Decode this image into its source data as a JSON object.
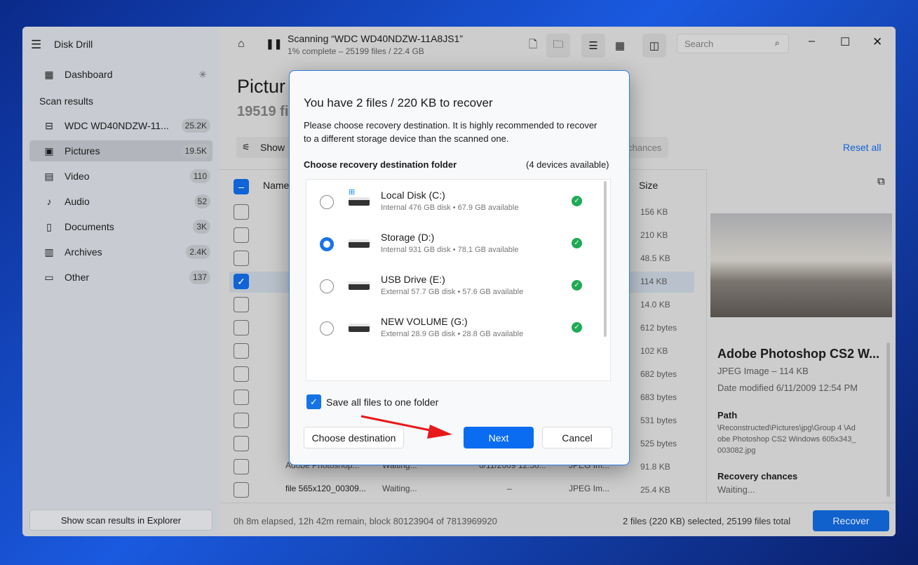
{
  "app": {
    "title": "Disk Drill"
  },
  "sidebar": {
    "dashboard": "Dashboard",
    "section": "Scan results",
    "items": [
      {
        "label": "WDC WD40NDZW-11...",
        "count": "25.2K",
        "icon": "hdd-icon"
      },
      {
        "label": "Pictures",
        "count": "19.5K",
        "icon": "picture-icon"
      },
      {
        "label": "Video",
        "count": "110",
        "icon": "film-icon"
      },
      {
        "label": "Audio",
        "count": "52",
        "icon": "music-icon"
      },
      {
        "label": "Documents",
        "count": "3K",
        "icon": "document-icon"
      },
      {
        "label": "Archives",
        "count": "2.4K",
        "icon": "archive-icon"
      },
      {
        "label": "Other",
        "count": "137",
        "icon": "other-icon"
      }
    ],
    "explorer_button": "Show scan results in Explorer"
  },
  "header": {
    "title": "Scanning “WDC WD40NDZW-11A8JS1”",
    "subtitle": "1% complete – 25199 files / 22.4 GB",
    "search_placeholder": "Search"
  },
  "page": {
    "title": "Pictur",
    "count": "19519 fil",
    "show_label": "Show",
    "chances_label": "chances",
    "reset_all": "Reset all"
  },
  "table": {
    "col_name": "Name",
    "col_size": "Size",
    "sizes": [
      "156 KB",
      "210 KB",
      "48.5 KB",
      "114 KB",
      "14.0 KB",
      "612 bytes",
      "102 KB",
      "682 bytes",
      "683 bytes",
      "531 bytes",
      "525 bytes",
      "91.8 KB",
      "25.4 KB"
    ],
    "checked_index": 3,
    "partial_rows": [
      {
        "name": "Adobe Photoshop...",
        "status": "Waiting...",
        "date": "6/11/2009 12:50...",
        "type": "JPEG Im..."
      },
      {
        "name": "file 565x120_00309...",
        "status": "Waiting...",
        "date": "–",
        "type": "JPEG Im..."
      }
    ]
  },
  "preview": {
    "title": "Adobe Photoshop CS2 W...",
    "type": "JPEG Image – 114 KB",
    "date": "Date modified 6/11/2009 12:54 PM",
    "path_label": "Path",
    "path": "\\Reconstructed\\Pictures\\jpg\\Group 4 \\Adobe Photoshop CS2 Windows 605x343_003082.jpg",
    "chances_label": "Recovery chances",
    "chances": "Waiting..."
  },
  "footer": {
    "elapsed": "0h 8m elapsed, 12h 42m remain, block 80123904 of 7813969920",
    "selection": "2 files (220 KB) selected, 25199 files total",
    "recover": "Recover"
  },
  "dialog": {
    "title": "You have 2 files / 220 KB to recover",
    "desc": "Please choose recovery destination. It is highly recommended to recover to a different storage device than the scanned one.",
    "folder_label": "Choose recovery destination folder",
    "devices_count": "(4 devices available)",
    "devices": [
      {
        "name": "Local Disk (C:)",
        "detail": "Internal 476 GB disk • 67.9 GB available",
        "selected": false
      },
      {
        "name": "Storage (D:)",
        "detail": "Internal 931 GB disk • 78.1 GB available",
        "selected": true
      },
      {
        "name": "USB Drive (E:)",
        "detail": "External 57.7 GB disk • 57.6 GB available",
        "selected": false
      },
      {
        "name": "NEW VOLUME (G:)",
        "detail": "External 28.9 GB disk • 28.8 GB available",
        "selected": false
      }
    ],
    "save_one_folder": "Save all files to one folder",
    "choose_dest": "Choose destination",
    "next": "Next",
    "cancel": "Cancel"
  },
  "colors": {
    "accent": "#0a6cf0",
    "ok": "#1faa55",
    "arrow": "#e8191b"
  }
}
